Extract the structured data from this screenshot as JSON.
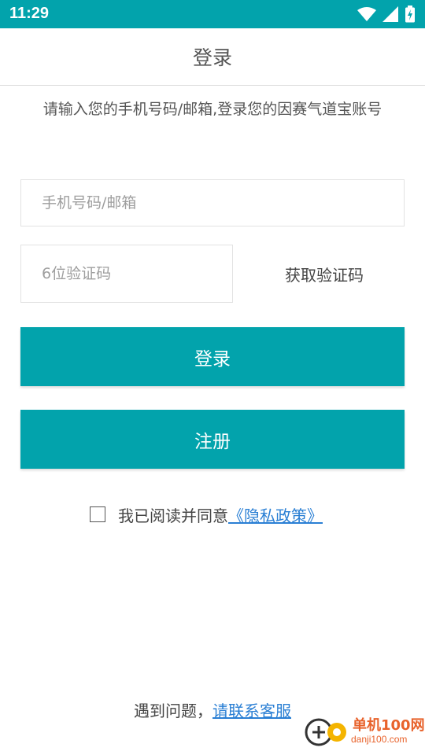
{
  "status_bar": {
    "time": "11:29",
    "icons": [
      "wifi-icon",
      "signal-icon",
      "battery-charging-icon"
    ],
    "color": "#02a3ac"
  },
  "header": {
    "title": "登录"
  },
  "subtitle": "请输入您的手机号码/邮箱,登录您的因赛气道宝账号",
  "form": {
    "phone_placeholder": "手机号码/邮箱",
    "code_placeholder": "6位验证码",
    "get_code_label": "获取验证码",
    "login_label": "登录",
    "register_label": "注册",
    "agree_text": "我已阅读并同意",
    "privacy_link": "《隐私政策》",
    "agreed": false
  },
  "footer": {
    "help_text": "遇到问题，",
    "contact_link": "请联系客服"
  },
  "watermark": {
    "text": "单机100网",
    "url_text": "danji100.com"
  },
  "colors": {
    "accent": "#02a3ac",
    "link": "#2a7fd4",
    "watermark": "#e8622b"
  }
}
